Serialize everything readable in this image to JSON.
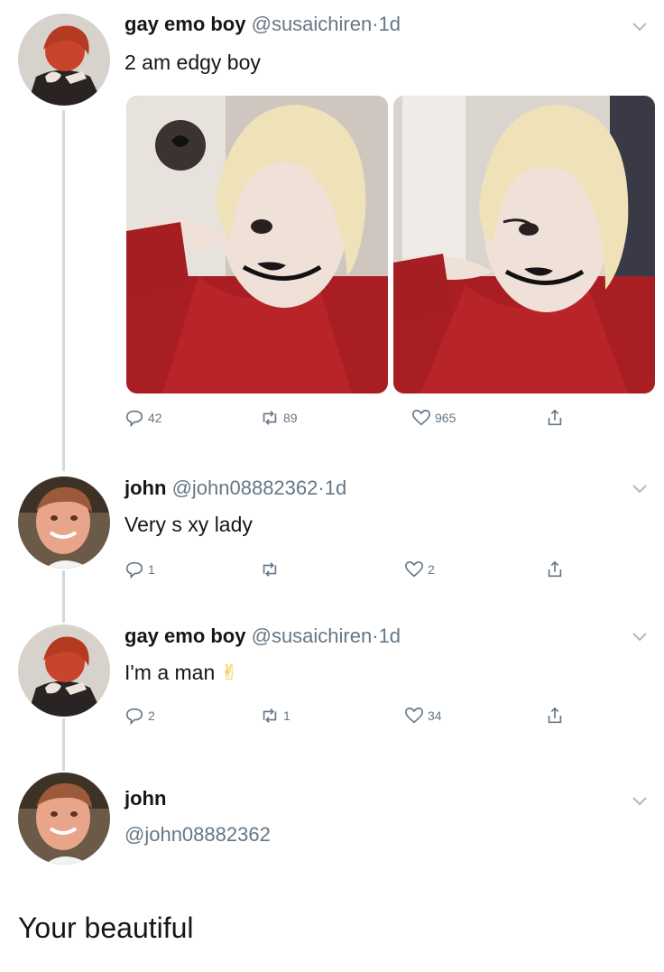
{
  "tweets": [
    {
      "name": "gay emo boy",
      "handle": "@susaichiren",
      "dot": "·",
      "time": "1d",
      "text": "2 am edgy boy",
      "replies": "42",
      "retweets": "89",
      "likes": "965"
    },
    {
      "name": "john",
      "handle": "@john08882362",
      "dot": "·",
      "time": "1d",
      "text": "Very s  xy lady",
      "replies": "1",
      "retweets": "",
      "likes": "2"
    },
    {
      "name": "gay emo boy",
      "handle": "@susaichiren",
      "dot": "·",
      "time": "1d",
      "text": "I'm a man",
      "emoji": "✌",
      "replies": "2",
      "retweets": "1",
      "likes": "34"
    }
  ],
  "focused": {
    "name": "john",
    "handle": "@john08882362",
    "text": "Your beautiful"
  },
  "icons": [
    "reply-icon",
    "retweet-icon",
    "like-icon",
    "share-icon",
    "chevron-down-icon"
  ]
}
